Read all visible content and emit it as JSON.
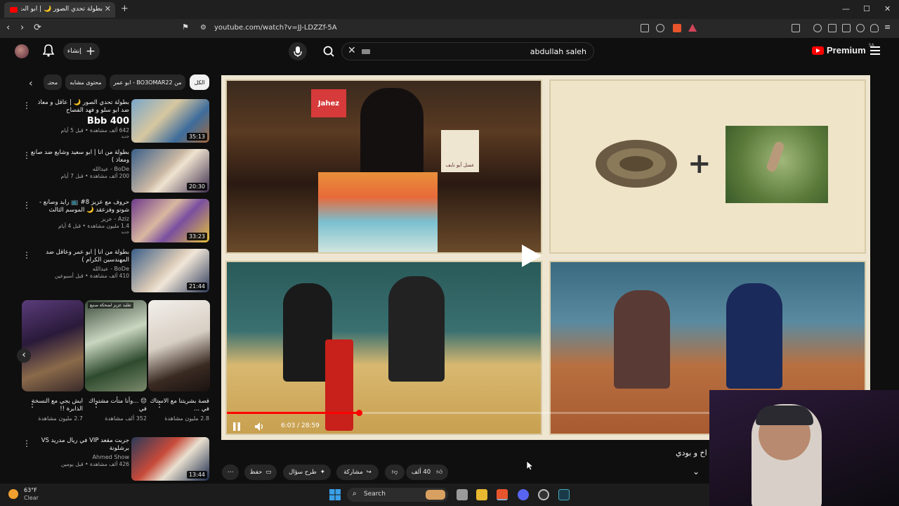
{
  "browser": {
    "tab_title": "بطولة تحدي الصور 🌙 | أبو الت...",
    "new_tab": "+",
    "url": "youtube.com/watch?v=JJ-LDZZf-5A",
    "window_controls": [
      "—",
      "☐",
      "✕"
    ]
  },
  "header": {
    "create_label": "إنشاء",
    "search_value": "abdullah saleh",
    "premium_label": "Premium",
    "region": "SA"
  },
  "chips": [
    {
      "label": "الكل"
    },
    {
      "label": "من BO3OMAR22 - ابو عمر"
    },
    {
      "label": "محتوى مشابه"
    },
    {
      "label": "محتـ"
    }
  ],
  "recommendations": [
    {
      "title": "بطولة تحدي الصور 🌙 | عاقل و معاذ ضد ابو سلو و فهد الفصاح",
      "channel": "Bbb 400",
      "meta": "642 ألف مشاهدة • قبل 5 أيام",
      "badge": "جديد",
      "duration": "35:13"
    },
    {
      "title": "بطولة من انا | ابو سعيد وشايع ضد صانع ومعاذ )",
      "channel": "BoDe - عبدالله",
      "meta": "200 ألف مشاهدة • قبل 7 أيام",
      "badge": "",
      "duration": "20:30"
    },
    {
      "title": "حروف مع عزيز 8# 📺 رايد وصانع - شوتو وفزعقد 🌙 الموسم الثالث",
      "channel": "Aziz - عزيز",
      "meta": "1.4 مليون مشاهدة • قبل 4 أيام",
      "badge": "جديد",
      "duration": "33:23"
    },
    {
      "title": "بطولة من انا | ابو عمر وعاقل ضد المهندسين الكرام )",
      "channel": "BoDe - عبدالله",
      "meta": "410 ألف مشاهدة • قبل أسبوعين",
      "badge": "",
      "duration": "21:44"
    },
    {
      "title": "جربت مقعد VIP في ريال مدريد VS برشلونة",
      "channel": "Ahmed Show",
      "meta": "426 ألف مشاهدة • قبل يومين",
      "badge": "",
      "duration": "13:44"
    }
  ],
  "shorts": [
    {
      "title": "قصة بشريتنا مع الاستاك في ...",
      "views": "2.8 مليون مشاهدة",
      "label": ""
    },
    {
      "title": "😔 ...وأنا متأت مشتراك في",
      "views": "352 ألف مشاهدة",
      "label": "تقليد عزيز لضحكة صنيع"
    },
    {
      "title": "ايش يجي مع النسخة الذابرة !!",
      "views": "2.7 مليون مشاهدة",
      "label": ""
    }
  ],
  "player": {
    "current_time": "6:03",
    "duration": "28:59",
    "time_display": "6:03 / 28:59",
    "progress": 0.208,
    "panel_text_jahez": "Jahez",
    "panel_text_sign": "عسل أبو نايف"
  },
  "video": {
    "title_fragment": "اخ و بودي",
    "likes": "40 ألف",
    "share_label": "مشاركة",
    "ask_label": "طرح سؤال",
    "save_label": "حفظ",
    "more_label": "⋯"
  },
  "taskbar": {
    "temperature": "63°F",
    "weather": "Clear",
    "search_label": "Search"
  },
  "colors": {
    "accent_red": "#ff0000",
    "bg": "#0f0f0f",
    "chip_bg": "#272727"
  }
}
